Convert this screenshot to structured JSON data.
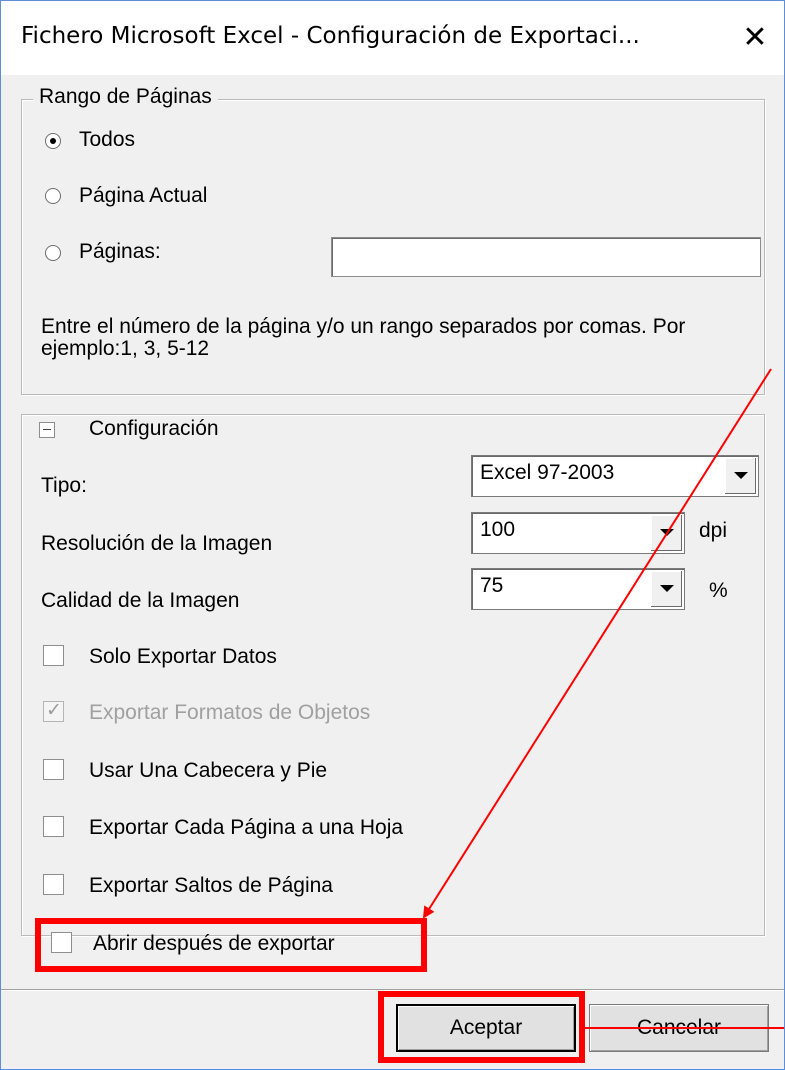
{
  "window": {
    "title": "Fichero Microsoft Excel - Configuración de Exportaci...",
    "close_icon": "close-icon"
  },
  "page_range": {
    "legend": "Rango de Páginas",
    "options": [
      {
        "label": "Todos",
        "selected": true
      },
      {
        "label": "Página Actual",
        "selected": false
      },
      {
        "label": "Páginas:",
        "selected": false
      }
    ],
    "pages_value": "",
    "hint": "Entre el número de la página y/o  un rango separados por comas. Por ejemplo:1, 3, 5-12"
  },
  "settings": {
    "legend": "Configuración",
    "type_label": "Tipo:",
    "type_value": "Excel 97-2003",
    "resolution_label": "Resolución de la Imagen",
    "resolution_value": "100",
    "resolution_unit": "dpi",
    "quality_label": "Calidad de la Imagen",
    "quality_value": "75",
    "quality_unit": "%",
    "checkboxes": [
      {
        "label": "Solo Exportar Datos",
        "checked": false,
        "enabled": true
      },
      {
        "label": "Exportar Formatos de Objetos",
        "checked": true,
        "enabled": false
      },
      {
        "label": "Usar Una Cabecera y Pie",
        "checked": false,
        "enabled": true
      },
      {
        "label": "Exportar Cada Página a una Hoja",
        "checked": false,
        "enabled": true
      },
      {
        "label": "Exportar Saltos de Página",
        "checked": false,
        "enabled": true
      }
    ],
    "open_after": {
      "label": "Abrir después de exportar",
      "checked": false
    }
  },
  "buttons": {
    "ok": "Aceptar",
    "cancel": "Cancelar"
  },
  "colors": {
    "annotation": "#ff0000",
    "title_border": "#5e8ed8"
  }
}
